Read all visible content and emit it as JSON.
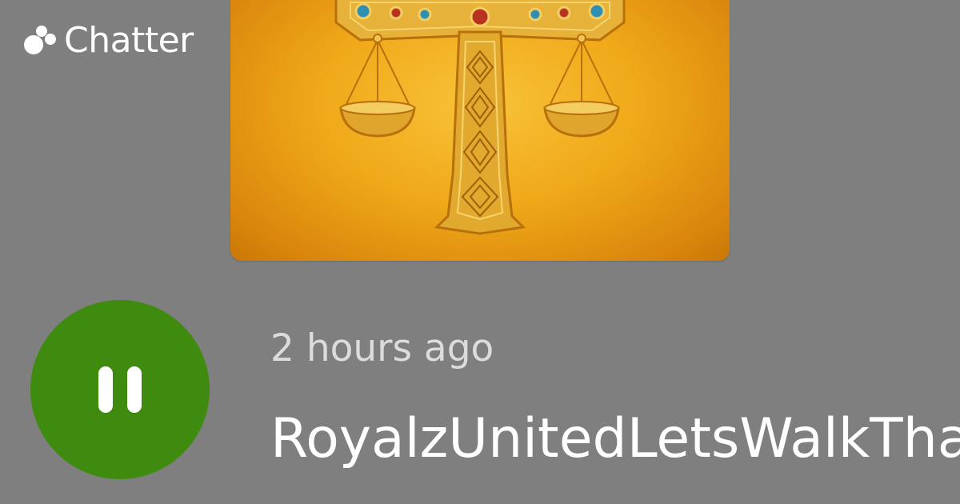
{
  "brand": {
    "name": "Chatter",
    "icon": "chatter-logo-icon"
  },
  "artwork": {
    "icon": "golden-cross-scales-icon",
    "colors": {
      "background": "#f0a919",
      "gold": "#e6b23a",
      "gem_blue": "#2f8fb2",
      "gem_red": "#b9321f"
    }
  },
  "player": {
    "state_icon": "pause-icon",
    "button_color": "#3f8b0f"
  },
  "episode": {
    "time_ago": "2 hours ago",
    "title": "RoyalzUnitedLetsWalkThatT"
  }
}
